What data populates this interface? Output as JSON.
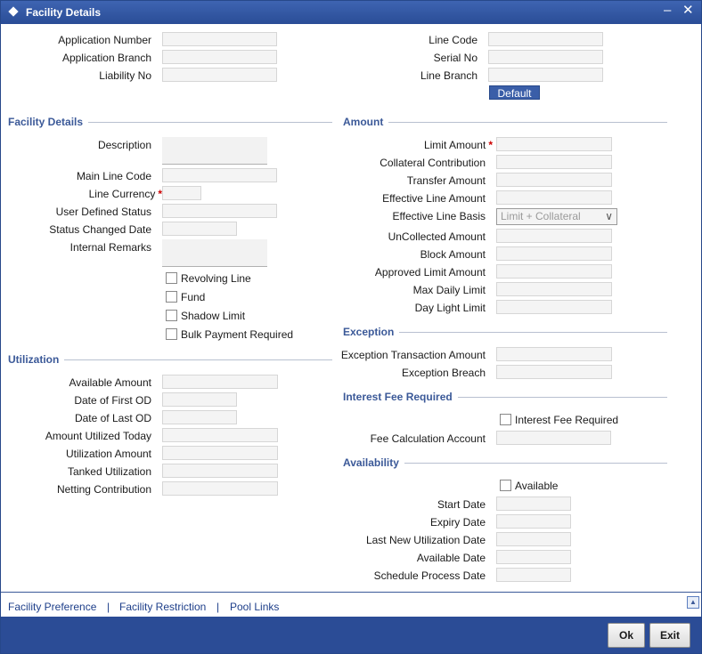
{
  "window": {
    "title": "Facility Details",
    "minimize_icon": "minus",
    "close_icon": "x"
  },
  "header": {
    "application_number": "Application Number",
    "application_branch": "Application Branch",
    "liability_no": "Liability No",
    "line_code": "Line Code",
    "serial_no": "Serial No",
    "line_branch": "Line Branch",
    "default_button": "Default"
  },
  "facility_details": {
    "title": "Facility Details",
    "description": "Description",
    "main_line_code": "Main Line Code",
    "line_currency": "Line Currency",
    "user_defined_status": "User Defined Status",
    "status_changed_date": "Status Changed Date",
    "internal_remarks": "Internal Remarks",
    "checkboxes": [
      "Revolving Line",
      "Fund",
      "Shadow Limit",
      "Bulk Payment Required"
    ]
  },
  "required_marker": "*",
  "utilization": {
    "title": "Utilization",
    "available_amount": "Available Amount",
    "date_first_od": "Date of First OD",
    "date_last_od": "Date of Last OD",
    "amount_utilized_today": "Amount Utilized Today",
    "utilization_amount": "Utilization Amount",
    "tanked_utilization": "Tanked Utilization",
    "netting_contribution": "Netting Contribution"
  },
  "amount": {
    "title": "Amount",
    "limit_amount": "Limit Amount",
    "collateral_contribution": "Collateral Contribution",
    "transfer_amount": "Transfer Amount",
    "effective_line_amount": "Effective Line Amount",
    "effective_line_basis": "Effective Line Basis",
    "effective_line_basis_value": "Limit + Collateral",
    "uncollected_amount": "UnCollected Amount",
    "block_amount": "Block Amount",
    "approved_limit_amount": "Approved Limit Amount",
    "max_daily_limit": "Max Daily Limit",
    "day_light_limit": "Day Light Limit"
  },
  "exception": {
    "title": "Exception",
    "exception_transaction_amount": "Exception Transaction Amount",
    "exception_breach": "Exception Breach"
  },
  "interest_fee": {
    "title": "Interest Fee Required",
    "checkbox": "Interest Fee Required",
    "fee_calculation_account": "Fee Calculation Account"
  },
  "availability": {
    "title": "Availability",
    "checkbox": "Available",
    "start_date": "Start Date",
    "expiry_date": "Expiry Date",
    "last_new_utilization_date": "Last New Utilization Date",
    "available_date": "Available Date",
    "schedule_process_date": "Schedule Process Date"
  },
  "links": [
    "Facility Preference",
    "Facility Restriction",
    "Pool Links"
  ],
  "link_separator": "|",
  "footer": {
    "ok": "Ok",
    "exit": "Exit"
  }
}
